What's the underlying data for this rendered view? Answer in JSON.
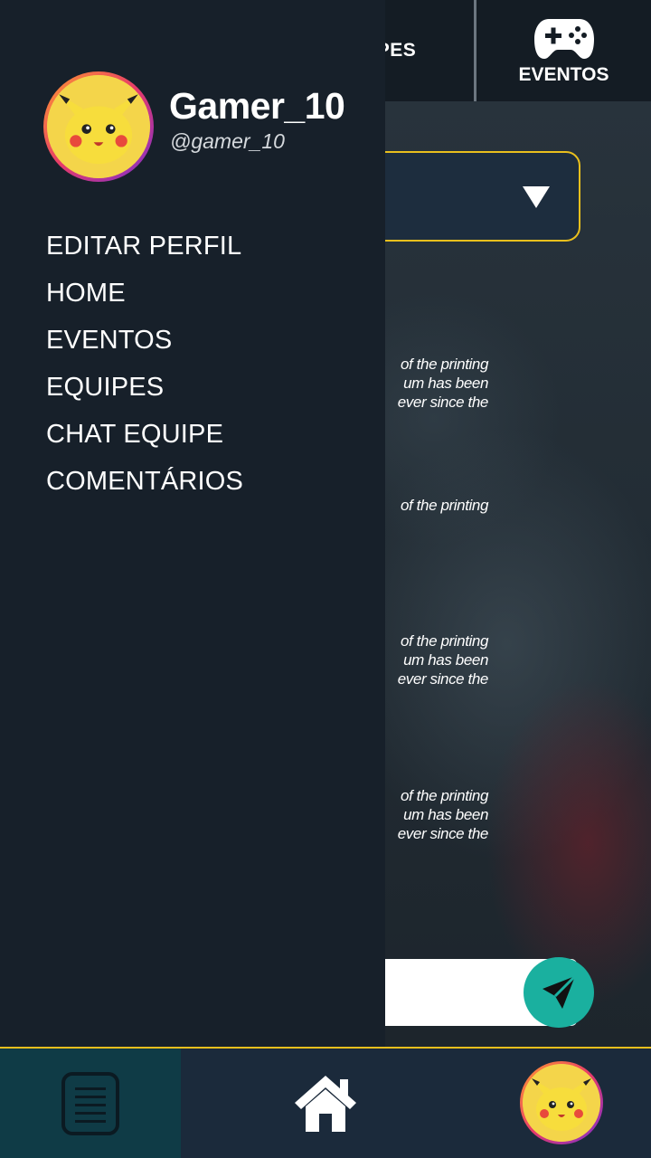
{
  "topbar": {
    "tab_equipes_label": "UIPES",
    "tab_eventos_label": "EVENTOS"
  },
  "comments": [
    {
      "lines": [
        "of the printing",
        "um has been",
        "ever since the"
      ]
    },
    {
      "lines": [
        "of the printing"
      ]
    },
    {
      "lines": [
        "of the printing",
        "um has been",
        "ever since the"
      ]
    },
    {
      "lines": [
        "of the printing",
        "um has been",
        "ever since the"
      ]
    }
  ],
  "drawer": {
    "username": "Gamer_10",
    "handle": "@gamer_10",
    "menu": [
      {
        "label": "EDITAR PERFIL"
      },
      {
        "label": "HOME"
      },
      {
        "label": "EVENTOS"
      },
      {
        "label": "EQUIPES"
      },
      {
        "label": "CHAT EQUIPE"
      },
      {
        "label": "COMENTÁRIOS"
      }
    ]
  },
  "icons": {
    "gamepad": "gamepad-icon",
    "dropdown": "caret-down-icon",
    "send": "send-icon",
    "menu": "document-list-icon",
    "home": "home-icon",
    "avatar": "pikachu-avatar"
  },
  "colors": {
    "accent": "#e9bf1d",
    "send_button": "#1ab09f",
    "drawer_bg": "#17202a",
    "bottom_nav_bg": "#1b2a3b",
    "active_nav_bg": "#0f3b46"
  }
}
